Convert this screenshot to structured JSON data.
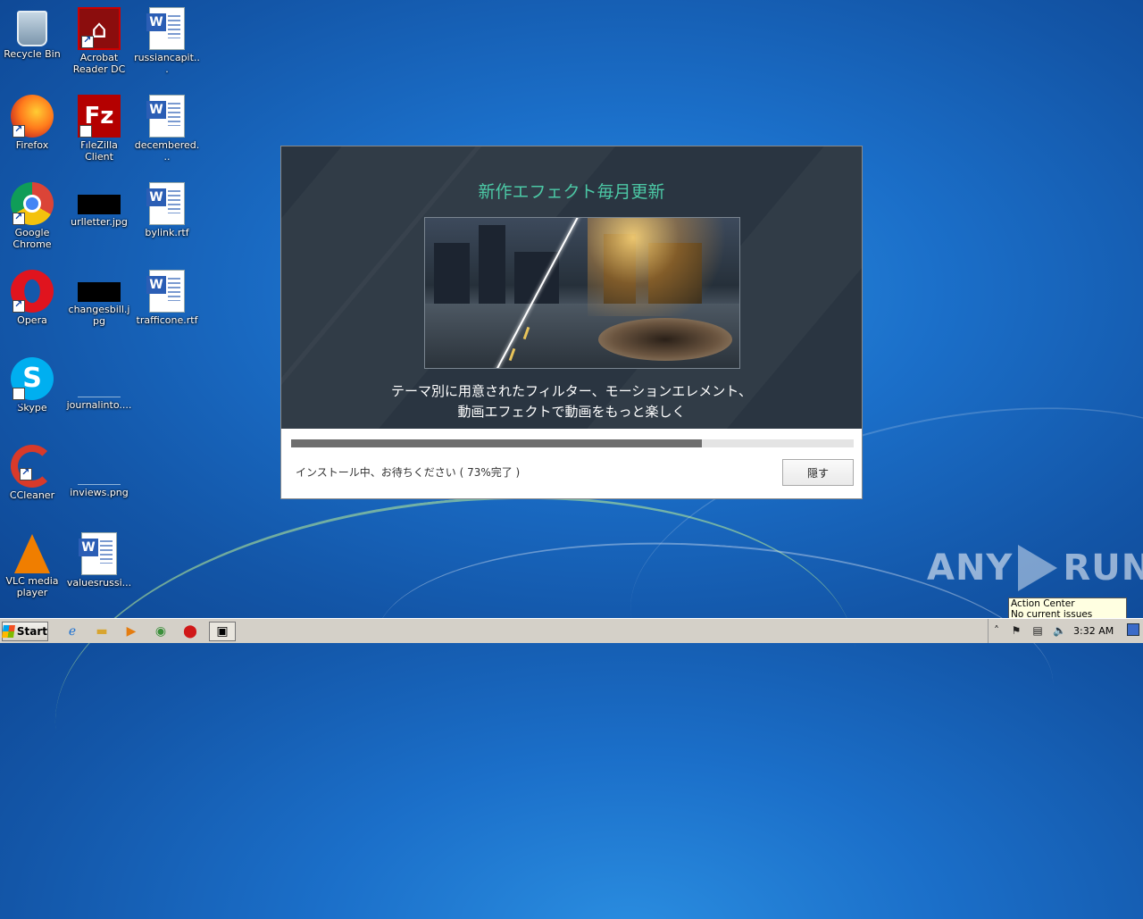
{
  "desktop": {
    "icons": [
      {
        "label": "Recycle Bin",
        "icon": "recycle-bin-icon"
      },
      {
        "label": "Acrobat Reader DC",
        "icon": "acrobat-icon"
      },
      {
        "label": "russiancapit...",
        "icon": "word-doc-icon"
      },
      {
        "label": "Firefox",
        "icon": "firefox-icon"
      },
      {
        "label": "FileZilla Client",
        "icon": "filezilla-icon"
      },
      {
        "label": "decembered...",
        "icon": "word-doc-icon"
      },
      {
        "label": "Google Chrome",
        "icon": "chrome-icon"
      },
      {
        "label": "urlletter.jpg",
        "icon": "image-file-icon"
      },
      {
        "label": "bylink.rtf",
        "icon": "word-doc-icon"
      },
      {
        "label": "Opera",
        "icon": "opera-icon"
      },
      {
        "label": "changesbill.jpg",
        "icon": "image-file-icon"
      },
      {
        "label": "trafficone.rtf",
        "icon": "word-doc-icon"
      },
      {
        "label": "Skype",
        "icon": "skype-icon"
      },
      {
        "label": "journalinto....",
        "icon": "blank-file-icon"
      },
      {
        "label": "CCleaner",
        "icon": "ccleaner-icon"
      },
      {
        "label": "inviews.png",
        "icon": "blank-file-icon"
      },
      {
        "label": "VLC media player",
        "icon": "vlc-icon"
      },
      {
        "label": "valuesrussi...",
        "icon": "word-doc-icon"
      }
    ]
  },
  "installer": {
    "headline": "新作エフェクト毎月更新",
    "caption_line1": "テーマ別に用意されたフィルター、モーションエレメント、",
    "caption_line2": "動画エフェクトで動画をもっと楽しく",
    "progress": 0.73,
    "status_text": "インストール中、お待ちください ( 73%完了 )",
    "hide_button": "隠す",
    "colors": {
      "accent": "#4cc9a6",
      "banner_bg": "#2a3541",
      "progress_fill": "#6e6e6e"
    }
  },
  "watermark": {
    "text_left": "ANY",
    "text_right": "RUN"
  },
  "tooltip": {
    "title": "Action Center",
    "message": "No current issues detected"
  },
  "taskbar": {
    "start_label": "Start",
    "pinned": [
      "internet-explorer-icon",
      "explorer-folder-icon",
      "media-player-icon",
      "chrome-icon",
      "opera-icon",
      "installer-app-icon"
    ],
    "clock": "3:32 AM"
  }
}
